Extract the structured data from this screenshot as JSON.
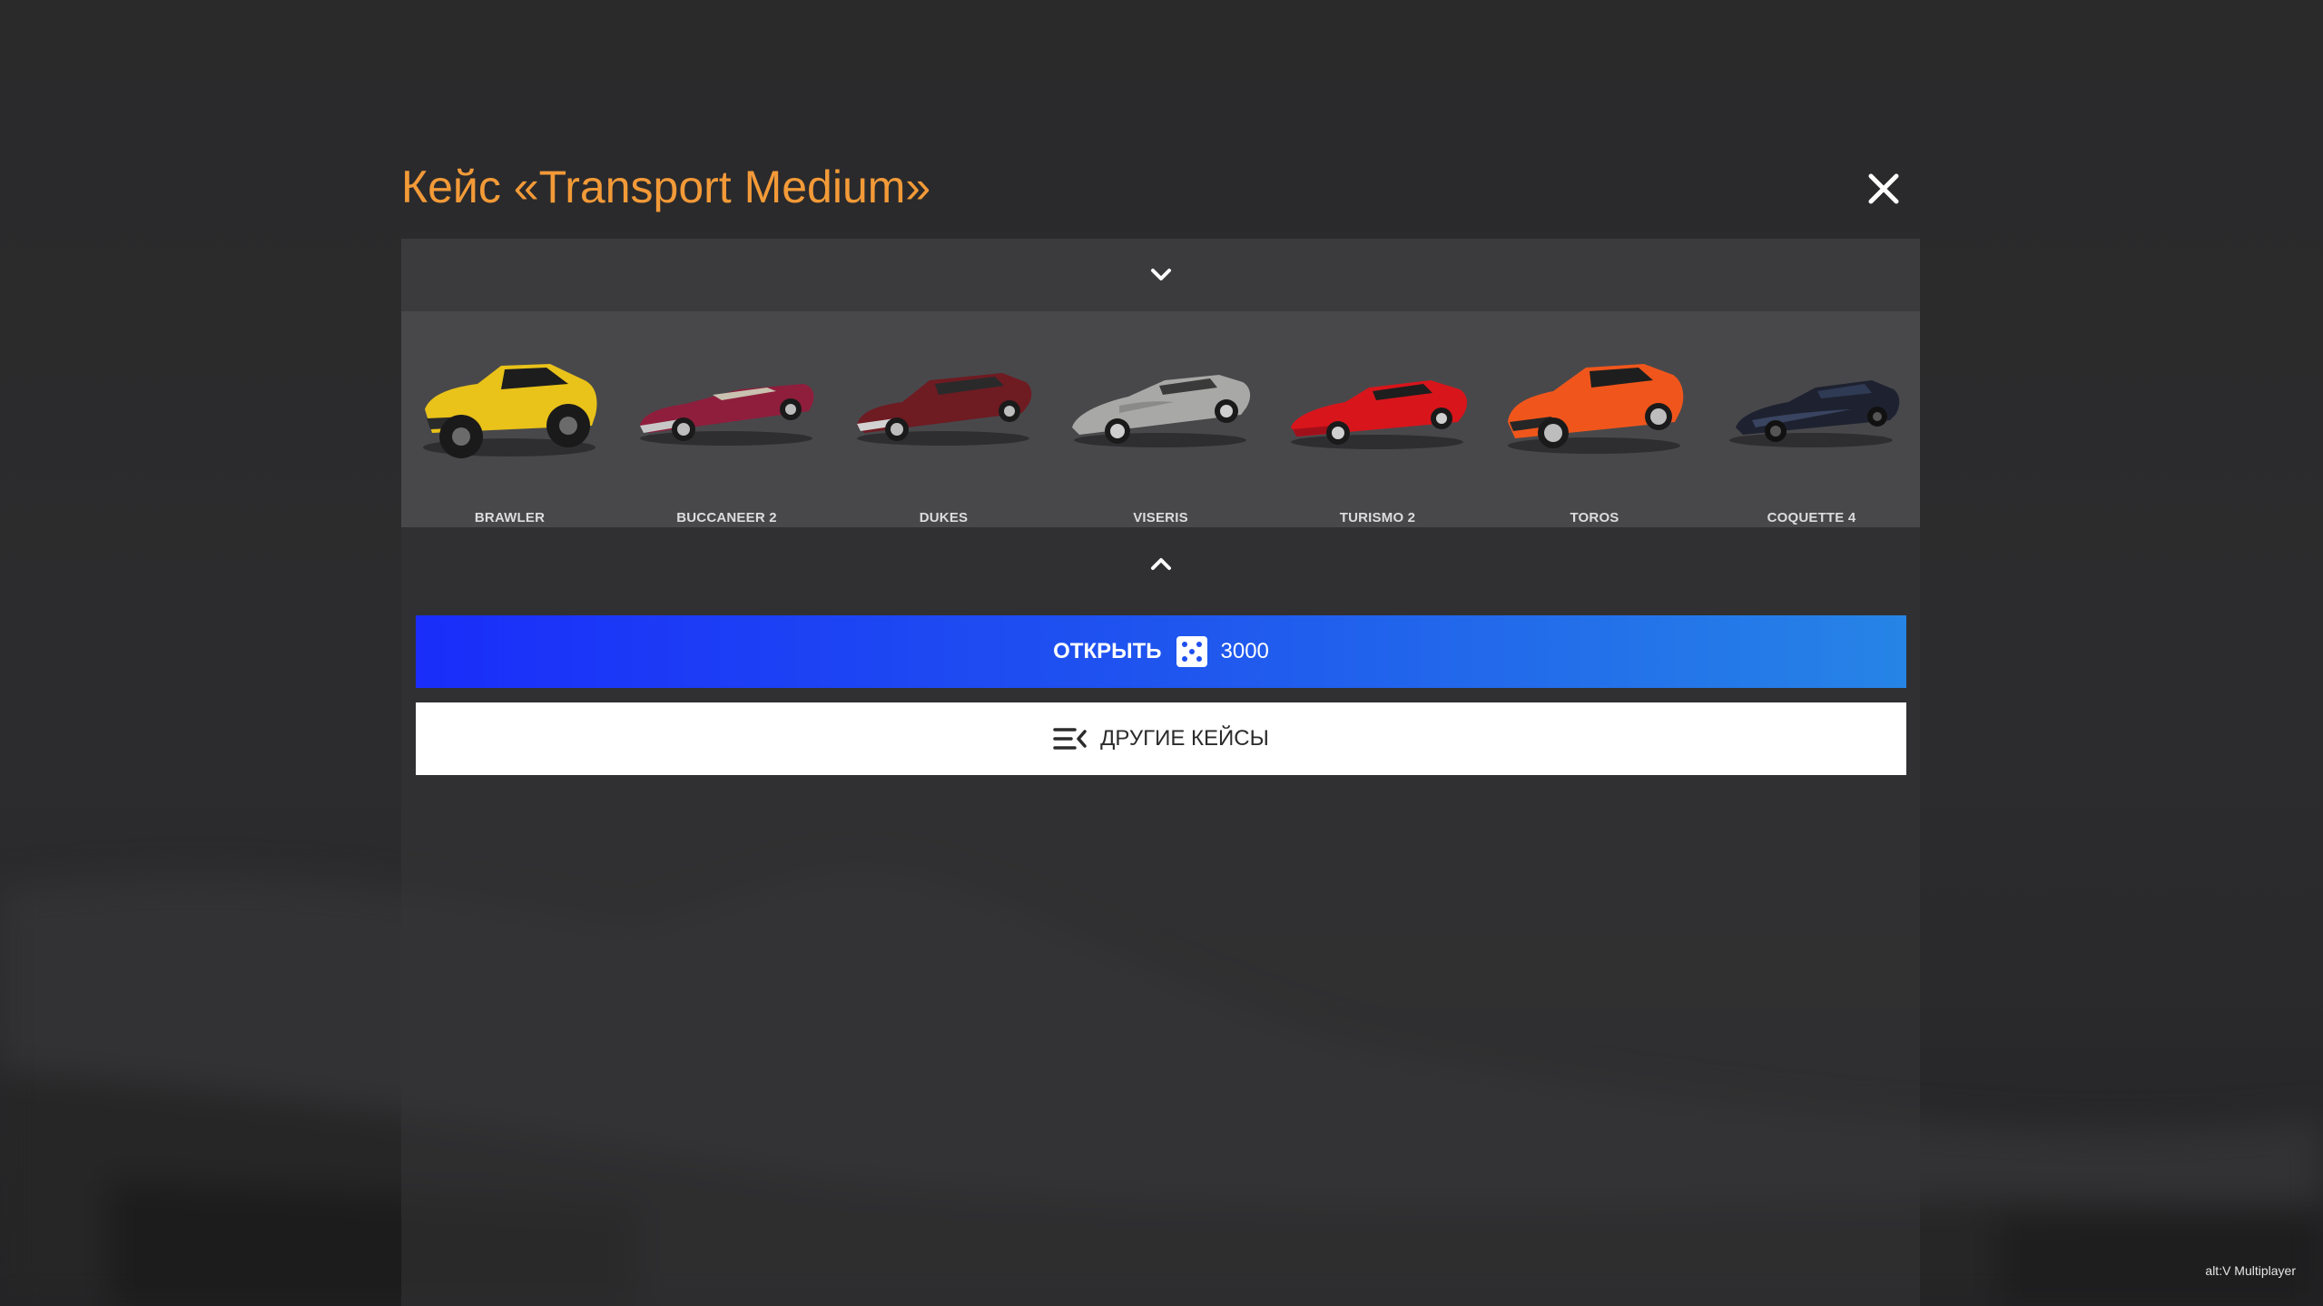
{
  "modal": {
    "title": "Кейс «Transport Medium»",
    "close_icon": "close-icon",
    "accent_color": "#f39a38"
  },
  "strip": {
    "scroll_up_icon": "chevron-down-icon",
    "scroll_down_icon": "chevron-up-icon",
    "cars": [
      {
        "label": "BRAWLER",
        "color": "#e9c21a"
      },
      {
        "label": "BUCCANEER 2",
        "color": "#8e1e3c"
      },
      {
        "label": "DUKES",
        "color": "#6e1b22"
      },
      {
        "label": "VISERIS",
        "color": "#a8a8a6"
      },
      {
        "label": "TURISMO 2",
        "color": "#d8151b"
      },
      {
        "label": "TOROS",
        "color": "#f0561c"
      },
      {
        "label": "COQUETTE 4",
        "color": "#1e2230"
      }
    ]
  },
  "actions": {
    "open_label": "ОТКРЫТЬ",
    "open_price": "3000",
    "currency_icon": "dice-icon",
    "other_label": "ДРУГИЕ КЕЙСЫ",
    "other_icon": "list-collapse-icon",
    "open_gradient": [
      "#1a2dfa",
      "#2684e6"
    ]
  },
  "watermark": "alt:V Multiplayer"
}
